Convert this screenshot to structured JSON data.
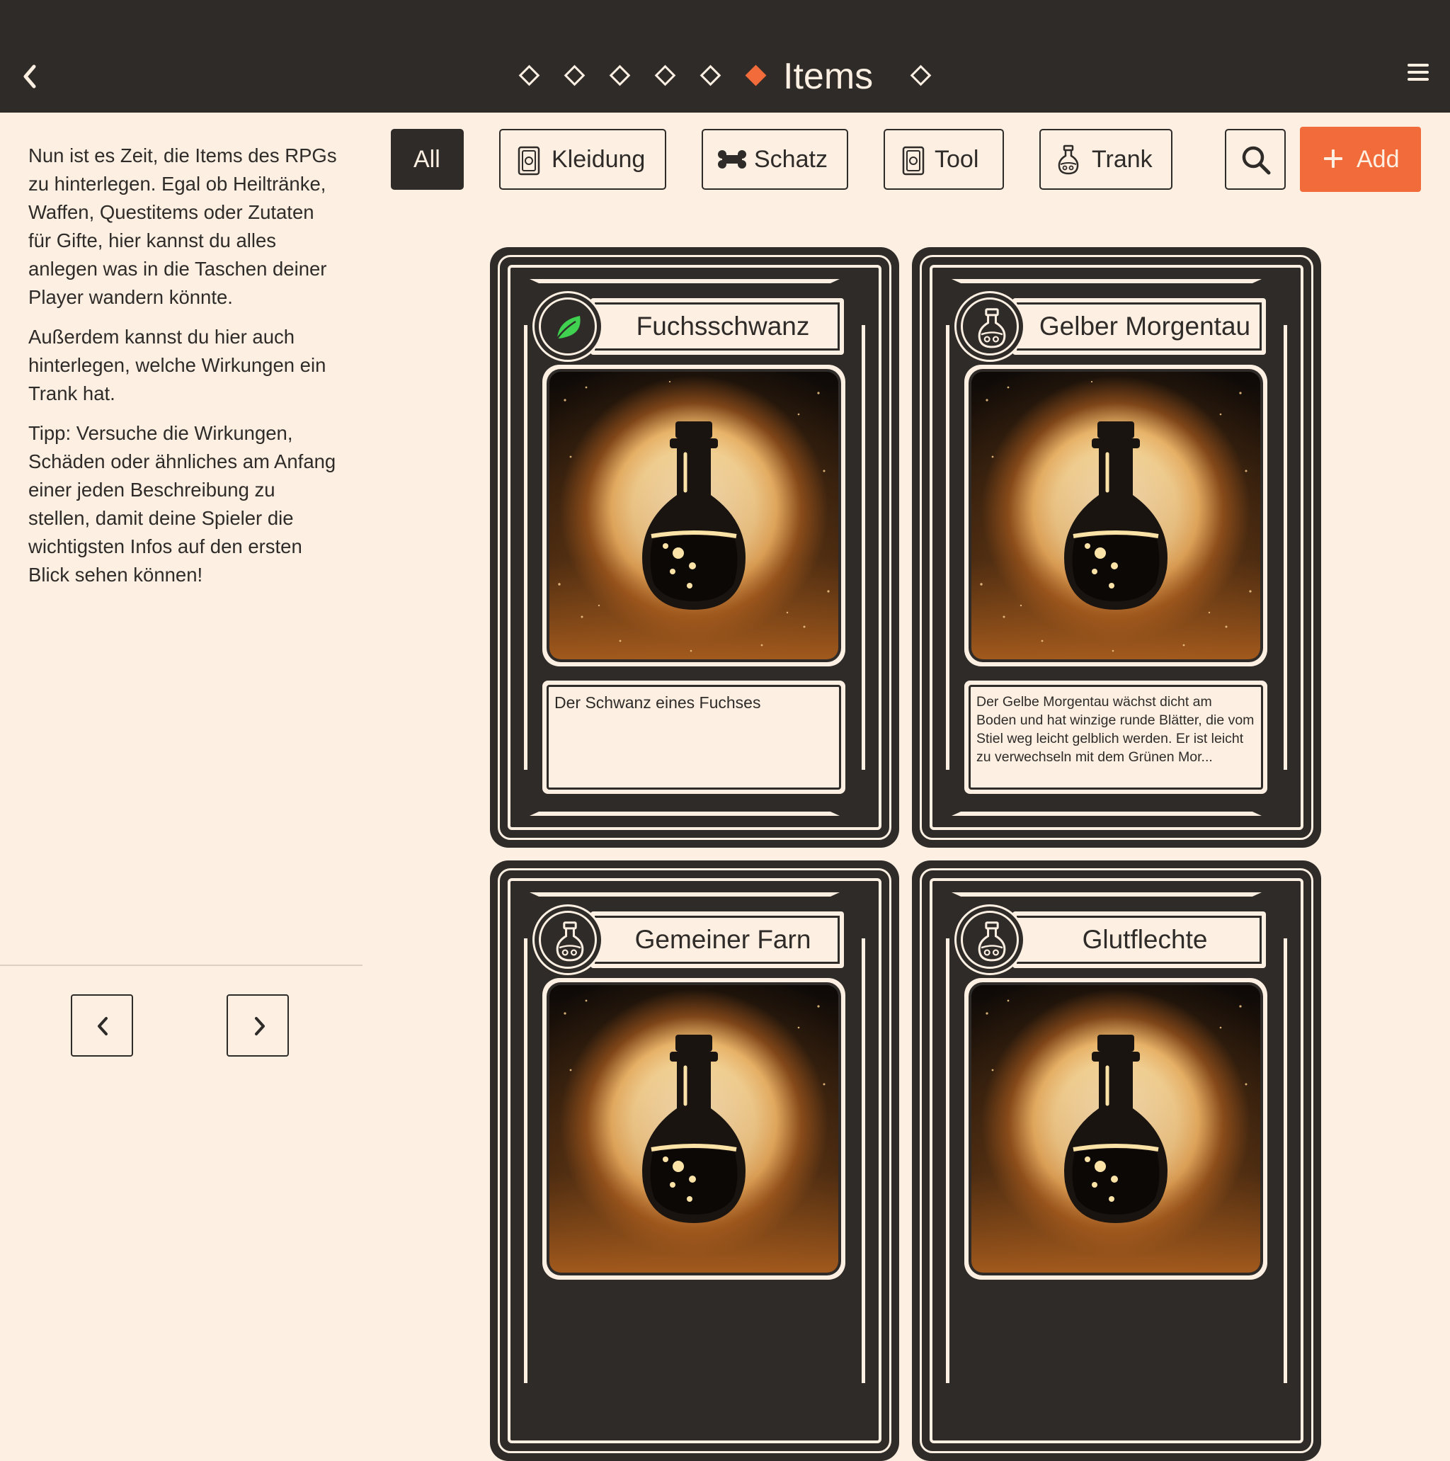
{
  "header": {
    "title": "Items",
    "steps": [
      "step-1",
      "step-2",
      "step-3",
      "step-4",
      "step-5",
      "items",
      "step-7"
    ],
    "active_step": "items",
    "accent_color": "#f26b3a",
    "bar_color": "#2e2b28"
  },
  "intro": {
    "p1": "Nun ist es Zeit, die Items des RPGs zu hinterlegen. Egal ob Heiltränke, Waffen, Questitems oder Zutaten für Gifte, hier kannst du alles anlegen was in die Taschen deiner Player wandern könnte.",
    "p2": "Außerdem kannst du hier auch hinterlegen, welche Wirkungen ein Trank hat.",
    "p3": "Tipp: Versuche die Wirkungen, Schäden oder ähnliches am Anfang einer jeden Beschreibung zu stellen, damit deine Spieler die wichtigsten Infos auf den ersten Blick sehen können!"
  },
  "filters": {
    "all": "All",
    "kleidung": "Kleidung",
    "schatz": "Schatz",
    "tool": "Tool",
    "trank": "Trank",
    "active": "All"
  },
  "toolbar": {
    "add_label": "Add"
  },
  "cards": [
    {
      "name": "Fuchsschwanz",
      "category_icon": "leaf-icon",
      "description": "Der Schwanz eines Fuchses"
    },
    {
      "name": "Gelber Morgentau",
      "category_icon": "potion-icon",
      "description": "Der Gelbe Morgentau wächst dicht am Boden und hat winzige runde Blätter, die vom Stiel weg leicht gelblich werden. Er ist leicht zu verwechseln mit dem Grünen Mor..."
    },
    {
      "name": "Gemeiner Farn",
      "category_icon": "potion-icon",
      "description": ""
    },
    {
      "name": "Glutflechte",
      "category_icon": "potion-icon",
      "description": ""
    }
  ]
}
